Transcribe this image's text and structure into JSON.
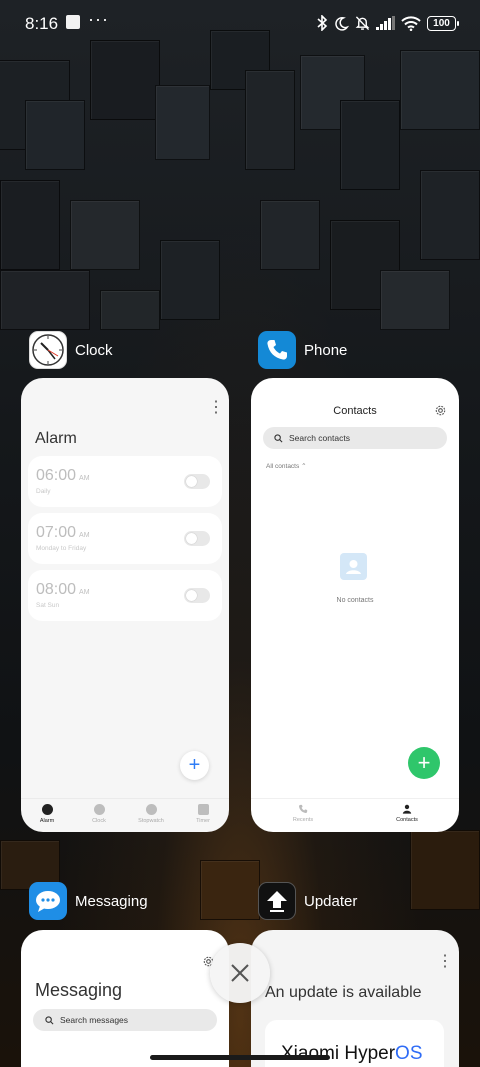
{
  "status_bar": {
    "time": "8:16",
    "battery": "100",
    "icons": [
      "gallery-icon",
      "more-icon",
      "bluetooth-icon",
      "dnd-moon-icon",
      "mute-bell-icon",
      "signal-icon",
      "wifi-icon",
      "battery-icon"
    ]
  },
  "apps": [
    {
      "name": "Clock",
      "icon": "clock-app-icon",
      "screen": {
        "title": "Alarm",
        "alarms": [
          {
            "time": "06:00",
            "ampm": "AM",
            "label": "Daily",
            "enabled": false
          },
          {
            "time": "07:00",
            "ampm": "AM",
            "label": "Monday to Friday",
            "enabled": false
          },
          {
            "time": "08:00",
            "ampm": "AM",
            "label": "Sat Sun",
            "enabled": false
          }
        ],
        "add_icon": "plus-icon",
        "nav": [
          {
            "label": "Alarm",
            "icon": "alarm-icon",
            "active": true
          },
          {
            "label": "Clock",
            "icon": "clock-icon",
            "active": false
          },
          {
            "label": "Stopwatch",
            "icon": "stopwatch-icon",
            "active": false
          },
          {
            "label": "Timer",
            "icon": "timer-icon",
            "active": false
          }
        ]
      }
    },
    {
      "name": "Phone",
      "icon": "phone-app-icon",
      "screen": {
        "title": "Contacts",
        "search_placeholder": "Search contacts",
        "filter": "All contacts",
        "empty": "No contacts",
        "add_icon": "plus-icon",
        "nav": [
          {
            "label": "Recents",
            "icon": "phone-icon",
            "active": false
          },
          {
            "label": "Contacts",
            "icon": "person-icon",
            "active": true
          }
        ]
      }
    },
    {
      "name": "Messaging",
      "icon": "messaging-app-icon",
      "screen": {
        "title": "Messaging",
        "search_placeholder": "Search messages"
      }
    },
    {
      "name": "Updater",
      "icon": "updater-app-icon",
      "screen": {
        "title": "An update is available",
        "brand_prefix": "Xiaomi Hyper",
        "brand_suffix": "OS"
      }
    }
  ],
  "close_all_icon": "close-icon",
  "colors": {
    "phone_accent": "#2fc66b",
    "updater_brand": "#2f6cf6",
    "clock_accent": "#2f7df6"
  }
}
